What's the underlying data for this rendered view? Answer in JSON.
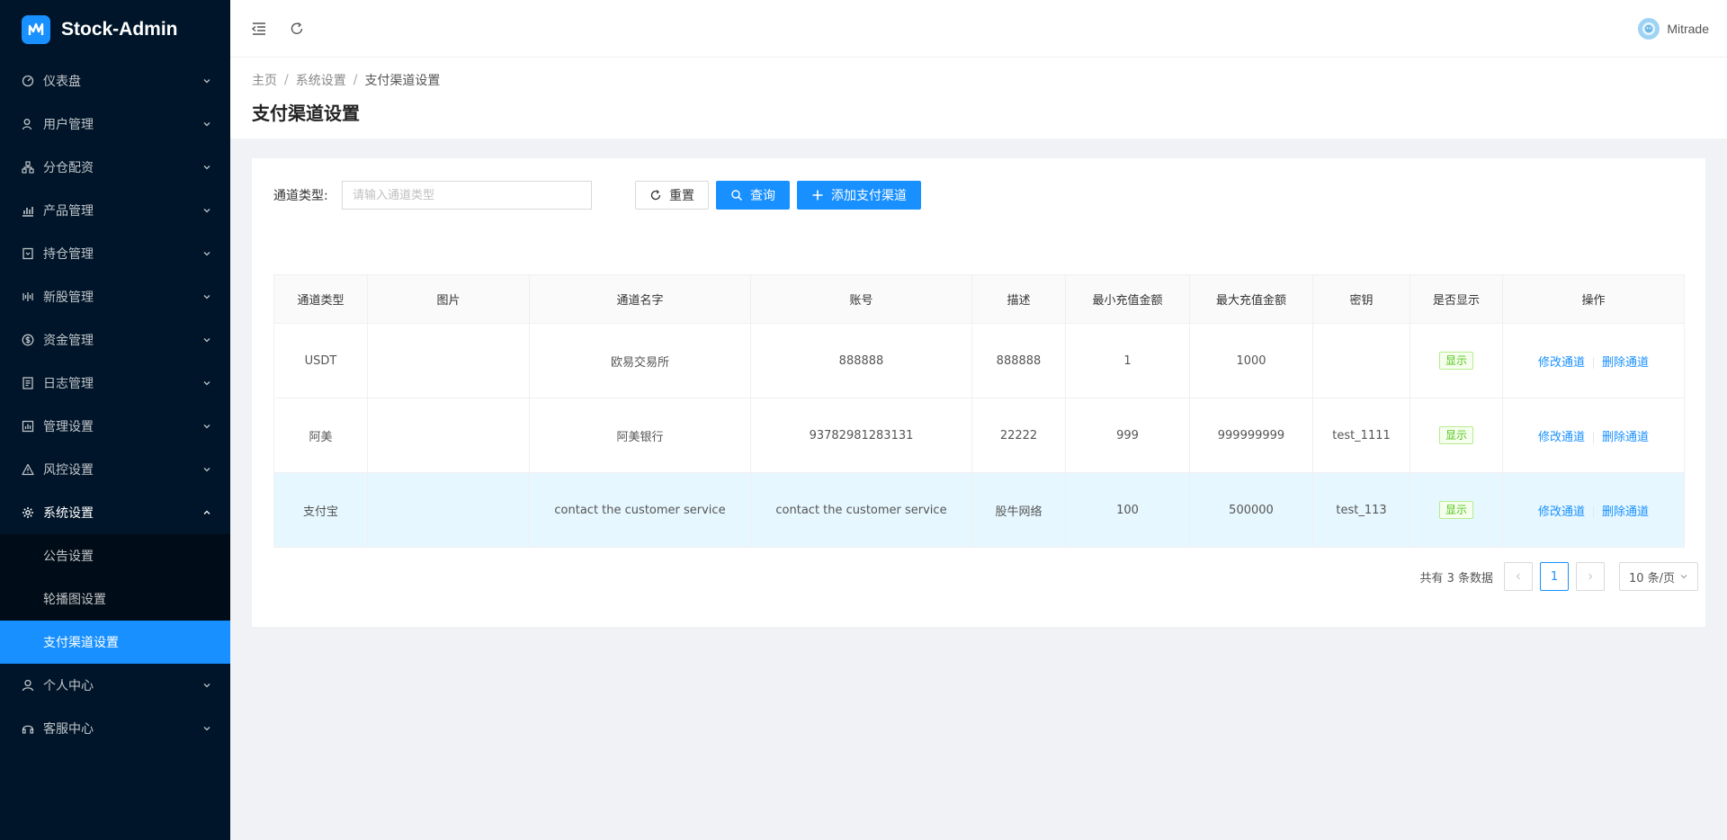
{
  "app": {
    "title": "Stock-Admin"
  },
  "sidebar": {
    "items": [
      {
        "label": "仪表盘",
        "icon": "dashboard-icon"
      },
      {
        "label": "用户管理",
        "icon": "user-manage-icon"
      },
      {
        "label": "分仓配资",
        "icon": "cluster-icon"
      },
      {
        "label": "产品管理",
        "icon": "bar-chart-icon"
      },
      {
        "label": "持仓管理",
        "icon": "position-icon"
      },
      {
        "label": "新股管理",
        "icon": "signal-icon"
      },
      {
        "label": "资金管理",
        "icon": "dollar-icon"
      },
      {
        "label": "日志管理",
        "icon": "log-icon"
      },
      {
        "label": "管理设置",
        "icon": "fund-icon"
      },
      {
        "label": "风控设置",
        "icon": "warning-icon"
      },
      {
        "label": "系统设置",
        "icon": "gear-icon"
      },
      {
        "label": "个人中心",
        "icon": "person-icon"
      },
      {
        "label": "客服中心",
        "icon": "headset-icon"
      }
    ],
    "system_sub": [
      {
        "label": "公告设置"
      },
      {
        "label": "轮播图设置"
      },
      {
        "label": "支付渠道设置"
      }
    ]
  },
  "header": {
    "user_name": "Mitrade"
  },
  "breadcrumb": {
    "home": "主页",
    "level2": "系统设置",
    "current": "支付渠道设置"
  },
  "page": {
    "title": "支付渠道设置"
  },
  "search": {
    "label": "通道类型:",
    "placeholder": "请输入通道类型",
    "reset_label": "重置",
    "query_label": "查询",
    "add_label": "添加支付渠道"
  },
  "table": {
    "columns": [
      "通道类型",
      "图片",
      "通道名字",
      "账号",
      "描述",
      "最小充值金额",
      "最大充值金额",
      "密钥",
      "是否显示",
      "操作"
    ],
    "rows": [
      {
        "type": "USDT",
        "image": "",
        "name": "欧易交易所",
        "account": "888888",
        "desc": "888888",
        "min": "1",
        "max": "1000",
        "key": "",
        "visible": "显示",
        "edit": "修改通道",
        "delete": "删除通道"
      },
      {
        "type": "阿美",
        "image": "",
        "name": "阿美银行",
        "account": "93782981283131",
        "desc": "22222",
        "min": "999",
        "max": "999999999",
        "key": "test_1111",
        "visible": "显示",
        "edit": "修改通道",
        "delete": "删除通道"
      },
      {
        "type": "支付宝",
        "image": "",
        "name": "contact the customer service",
        "account": "contact the customer service",
        "desc": "股牛网络",
        "min": "100",
        "max": "500000",
        "key": "test_113",
        "visible": "显示",
        "edit": "修改通道",
        "delete": "删除通道"
      }
    ]
  },
  "pagination": {
    "total_text": "共有 3 条数据",
    "current_page": "1",
    "page_size": "10 条/页"
  },
  "colors": {
    "primary": "#1890ff",
    "sidebar_bg": "#001529",
    "submenu_bg": "#000c17",
    "tag_green": "#52c41a"
  }
}
